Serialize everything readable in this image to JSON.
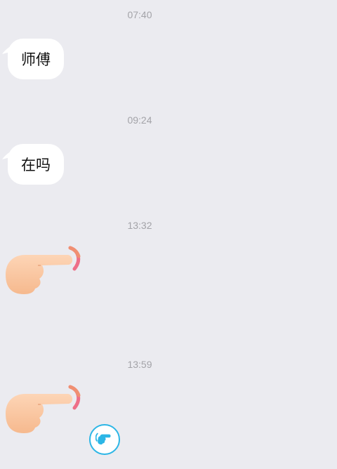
{
  "messages": [
    {
      "time": "07:40",
      "type": "text",
      "text": "师傅"
    },
    {
      "time": "09:24",
      "type": "text",
      "text": "在吗"
    },
    {
      "time": "13:32",
      "type": "emoji",
      "emoji": "finger-pointing-right-icon"
    },
    {
      "time": "13:59",
      "type": "emoji",
      "emoji": "finger-pointing-right-icon"
    }
  ],
  "badge": {
    "icon": "poke-hand-icon"
  },
  "colors": {
    "background": "#ebebf0",
    "bubble": "#ffffff",
    "timestamp": "#a3a3a8",
    "accent": "#2cb6e6",
    "skin": "#fcc9a5",
    "motion_arc": "#ee6f88"
  }
}
